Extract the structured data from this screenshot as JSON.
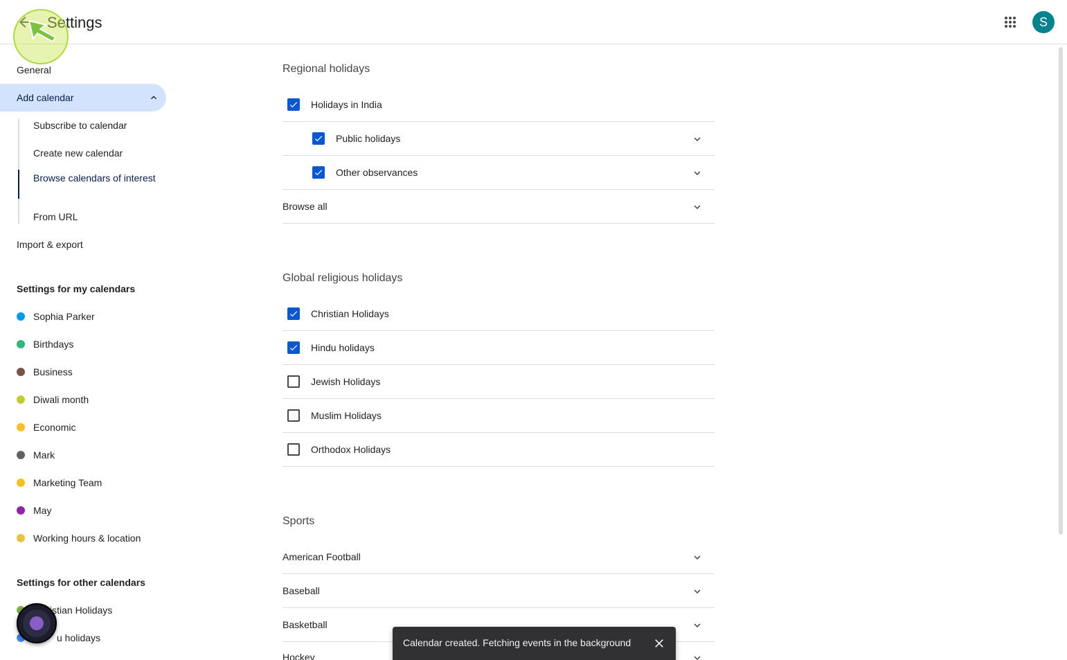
{
  "header": {
    "title": "Settings",
    "avatar_initial": "S"
  },
  "sidebar": {
    "general": "General",
    "add_calendar": "Add calendar",
    "sub_items": [
      "Subscribe to calendar",
      "Create new calendar",
      "Browse calendars of interest",
      "From URL"
    ],
    "import_export": "Import & export",
    "my_calendars_heading": "Settings for my calendars",
    "my_calendars": [
      {
        "label": "Sophia Parker",
        "color": "#039be5"
      },
      {
        "label": "Birthdays",
        "color": "#33b679"
      },
      {
        "label": "Business",
        "color": "#795548"
      },
      {
        "label": "Diwali month",
        "color": "#c0ca33"
      },
      {
        "label": "Economic",
        "color": "#f6bf26"
      },
      {
        "label": "Mark",
        "color": "#616161"
      },
      {
        "label": "Marketing Team",
        "color": "#f6bf26"
      },
      {
        "label": "May",
        "color": "#8e24aa"
      },
      {
        "label": "Working hours & location",
        "color": "#e4c441"
      }
    ],
    "other_calendars_heading": "Settings for other calendars",
    "other_calendars": [
      {
        "label": "Christian Holidays",
        "visible_label": "istian Holidays",
        "color": "#7cb342"
      },
      {
        "label": "Hindu holidays",
        "visible_label": "u holidays",
        "color": "#4285f4"
      }
    ]
  },
  "main": {
    "regional": {
      "title": "Regional holidays",
      "rows": [
        {
          "label": "Holidays in India",
          "checked": true
        },
        {
          "label": "Public holidays",
          "checked": true
        },
        {
          "label": "Other observances",
          "checked": true
        },
        {
          "label": "Browse all"
        }
      ]
    },
    "religious": {
      "title": "Global religious holidays",
      "rows": [
        {
          "label": "Christian Holidays",
          "checked": true
        },
        {
          "label": "Hindu holidays",
          "checked": true
        },
        {
          "label": "Jewish Holidays",
          "checked": false
        },
        {
          "label": "Muslim Holidays",
          "checked": false
        },
        {
          "label": "Orthodox Holidays",
          "checked": false
        }
      ]
    },
    "sports": {
      "title": "Sports",
      "rows": [
        "American Football",
        "Baseball",
        "Basketball",
        "Hockey"
      ]
    }
  },
  "snackbar": {
    "text": "Calendar created. Fetching events in the background"
  },
  "colors": {
    "accent": "#0b57d0",
    "active_nav_bg": "#d3e3fd",
    "avatar_bg": "#00838f",
    "snackbar_bg": "#313033"
  }
}
